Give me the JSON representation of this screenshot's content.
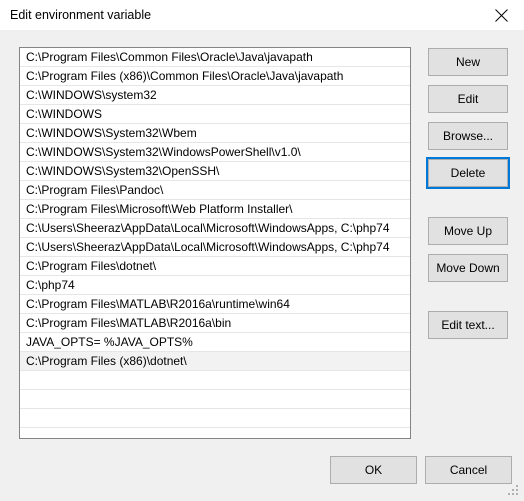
{
  "window": {
    "title": "Edit environment variable",
    "close_icon": "close-icon"
  },
  "list": {
    "items": [
      "C:\\Program Files\\Common Files\\Oracle\\Java\\javapath",
      "C:\\Program Files (x86)\\Common Files\\Oracle\\Java\\javapath",
      "C:\\WINDOWS\\system32",
      "C:\\WINDOWS",
      "C:\\WINDOWS\\System32\\Wbem",
      "C:\\WINDOWS\\System32\\WindowsPowerShell\\v1.0\\",
      "C:\\WINDOWS\\System32\\OpenSSH\\",
      "C:\\Program Files\\Pandoc\\",
      "C:\\Program Files\\Microsoft\\Web Platform Installer\\",
      "C:\\Users\\Sheeraz\\AppData\\Local\\Microsoft\\WindowsApps, C:\\php74",
      "C:\\Users\\Sheeraz\\AppData\\Local\\Microsoft\\WindowsApps, C:\\php74",
      "C:\\Program Files\\dotnet\\",
      "C:\\php74",
      "C:\\Program Files\\MATLAB\\R2016a\\runtime\\win64",
      "C:\\Program Files\\MATLAB\\R2016a\\bin",
      "JAVA_OPTS= %JAVA_OPTS%",
      "C:\\Program Files (x86)\\dotnet\\"
    ],
    "highlighted_index": 16,
    "empty_rows": 3
  },
  "side_buttons": {
    "new": "New",
    "edit": "Edit",
    "browse": "Browse...",
    "delete": "Delete",
    "move_up": "Move Up",
    "move_down": "Move Down",
    "edit_text": "Edit text..."
  },
  "bottom_buttons": {
    "ok": "OK",
    "cancel": "Cancel"
  },
  "colors": {
    "dialog_background": "#f0f0f0",
    "titlebar_background": "#ffffff",
    "button_face": "#e1e1e1",
    "button_border": "#adadad",
    "focus_ring": "#0078d7",
    "list_border": "#848484",
    "row_highlight": "#f2f2f2"
  }
}
